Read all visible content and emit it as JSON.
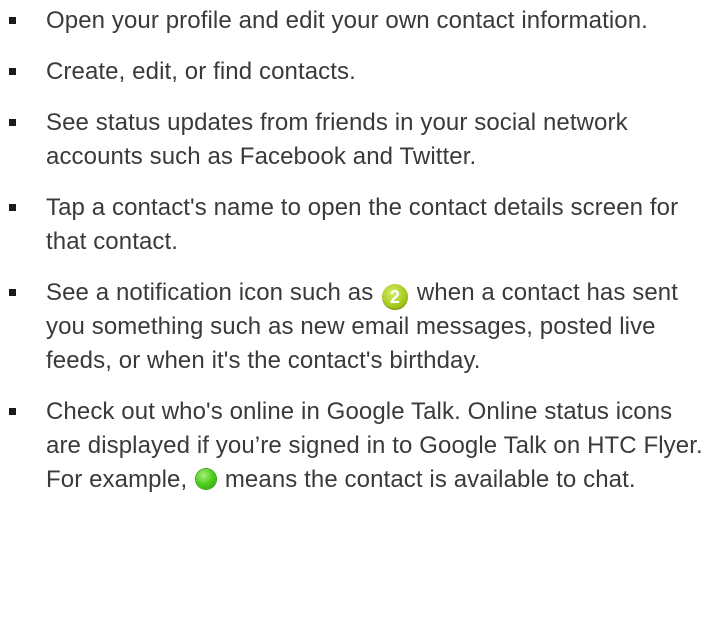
{
  "items": [
    {
      "text": "Open your profile and edit your own contact information."
    },
    {
      "text": "Create, edit, or find contacts."
    },
    {
      "text": "See status updates from friends in your social network accounts such as Facebook and Twitter."
    },
    {
      "text": "Tap a contact's name to open the contact details screen for that contact."
    },
    {
      "text_before": "See a notification icon such as",
      "badge_number": "2",
      "text_after": "when a contact has sent you something such as new email messages, posted live feeds, or when it's the contact's birthday."
    },
    {
      "text_before": "Check out who's online in Google Talk. Online status icons are displayed if you’re signed in to Google Talk on HTC Flyer. For example,",
      "icon": "online-status-icon",
      "text_after": "means the contact is available to chat."
    }
  ],
  "colors": {
    "text": "#3a3a3a",
    "bullet": "#1a1a1a",
    "badge_green": "#a6cc1e",
    "online_green": "#4ccd1a"
  }
}
